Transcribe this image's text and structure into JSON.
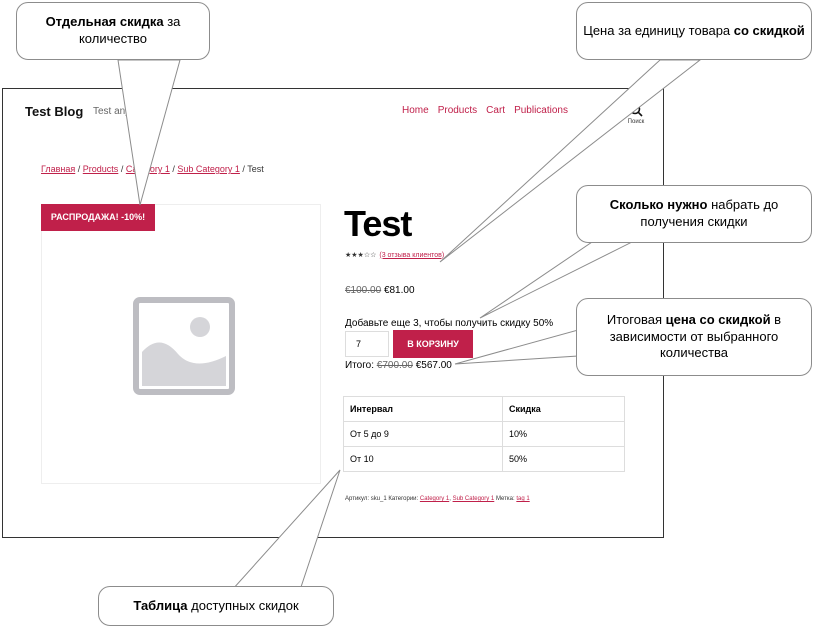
{
  "site": {
    "title": "Test Blog",
    "tagline": "Test anyth",
    "nav": [
      "Home",
      "Products",
      "Cart",
      "Publications"
    ],
    "search_label": "Поиск"
  },
  "breadcrumb": {
    "items": [
      "Главная",
      "Products",
      "Category 1",
      "Sub Category 1"
    ],
    "current": "Test"
  },
  "product": {
    "sale_badge": "РАСПРОДАЖА! -10%!",
    "title": "Test",
    "rating_stars": "★★★☆☆",
    "reviews": "(3 отзыва клиентов)",
    "price_old": "€100.00",
    "price_new": "€81.00",
    "promo": "Добавьте еще 3, чтобы получить скидку 50%",
    "qty_value": "7",
    "cart_button": "В КОРЗИНУ",
    "total_label": "Итого:",
    "total_old": "€700.00",
    "total_new": "€567.00"
  },
  "discount_table": {
    "headers": [
      "Интервал",
      "Скидка"
    ],
    "rows": [
      [
        "От 5 до 9",
        "10%"
      ],
      [
        "От 10",
        "50%"
      ]
    ]
  },
  "meta": {
    "sku_label": "Артикул: sku_1 Категории:",
    "cat1": "Category 1",
    "cat2": "Sub Category 1",
    "tag_label": "Метка:",
    "tag": "tag 1"
  },
  "callouts": {
    "c1_bold": "Отдельная скидка",
    "c1_rest": " за количество",
    "c2_text": "Цена за единицу товара ",
    "c2_bold": "со скидкой",
    "c3_bold": "Сколько нужно",
    "c3_rest": " набрать до получения скидки",
    "c4_text": "Итоговая ",
    "c4_bold": "цена со скидкой",
    "c4_rest": " в зависимости от выбранного количества",
    "c5_bold": "Таблица",
    "c5_rest": " доступных скидок"
  },
  "colors": {
    "accent": "#c0204a"
  }
}
